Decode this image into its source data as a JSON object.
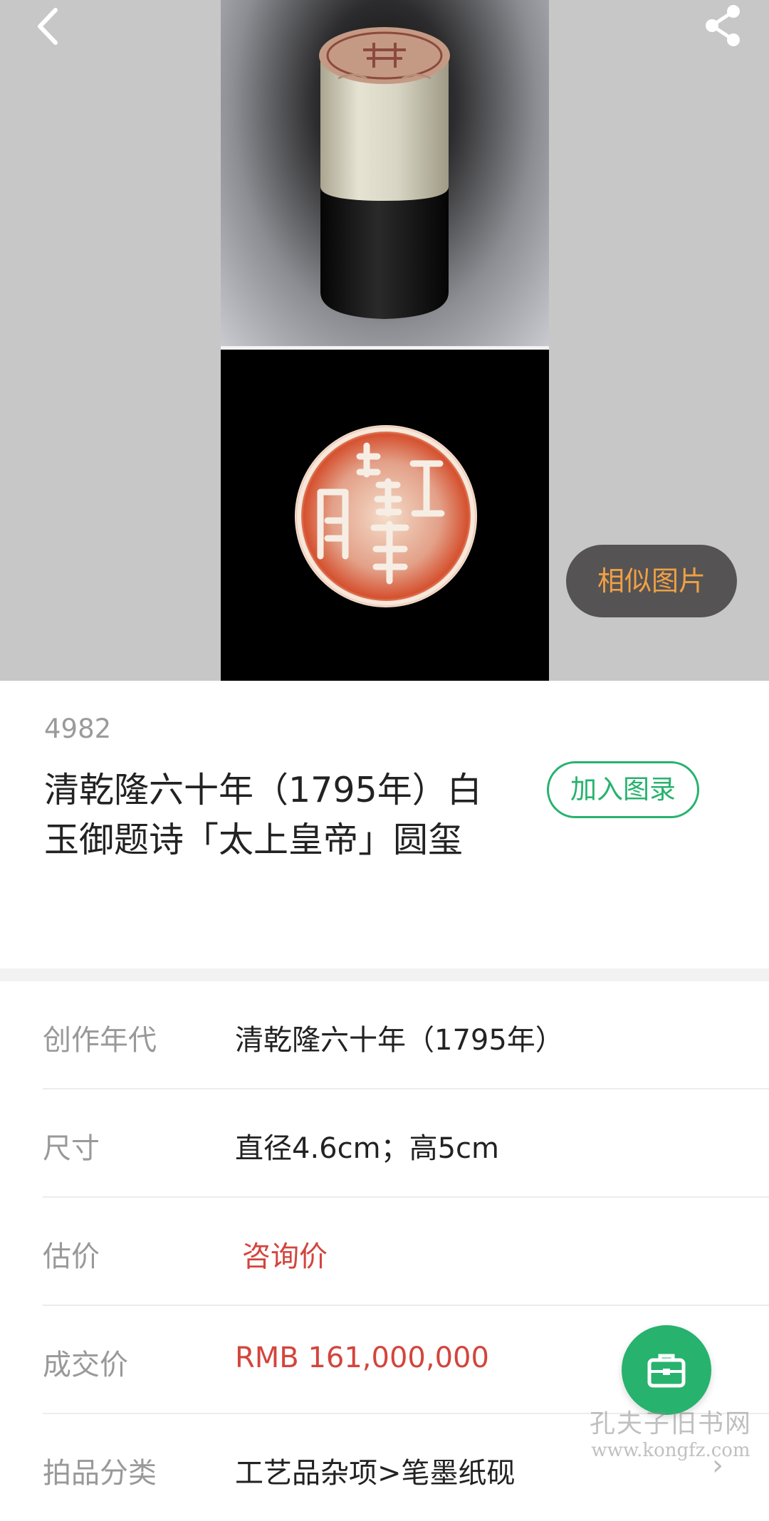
{
  "icons": {
    "back": "chevron-left-icon",
    "share": "share-icon",
    "fab": "briefcase-icon"
  },
  "colors": {
    "accent_green": "#27b26e",
    "price_red": "#d3453d",
    "similar_text": "#f0a044"
  },
  "hero": {
    "similar_images_label": "相似图片"
  },
  "lot": {
    "number": "4982",
    "title": "清乾隆六十年（1795年）白玉御题诗「太上皇帝」圆玺",
    "add_catalog_label": "加入图录"
  },
  "details": [
    {
      "label": "创作年代",
      "value": "清乾隆六十年（1795年）"
    },
    {
      "label": "尺寸",
      "value": "直径4.6cm；高5cm"
    },
    {
      "label": "估价",
      "value": "咨询价"
    },
    {
      "label": "成交价",
      "value": "RMB 161,000,000"
    },
    {
      "label": "拍品分类",
      "value": "工艺品杂项>笔墨纸砚"
    }
  ],
  "watermark": {
    "main": "孔夫子旧书网",
    "url": "www.kongfz.com"
  }
}
